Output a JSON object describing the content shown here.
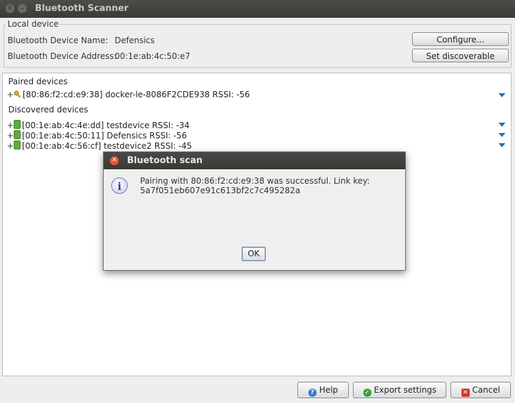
{
  "window": {
    "title": "Bluetooth Scanner"
  },
  "local": {
    "legend": "Local device",
    "name_label": "Bluetooth Device Name:",
    "name_value": "Defensics",
    "address_label": "Bluetooth Device Address:",
    "address_value": "00:1e:ab:4c:50:e7",
    "configure_label": "Configure...",
    "discoverable_label": "Set discoverable"
  },
  "paired": {
    "heading": "Paired devices",
    "items": [
      {
        "text": "[80:86:f2:cd:e9:38] docker-le-8086F2CDE938 RSSI: -56"
      }
    ]
  },
  "discovered": {
    "heading": "Discovered devices",
    "items": [
      {
        "text": "[00:1e:ab:4c:4e:dd] testdevice RSSI: -34"
      },
      {
        "text": "[00:1e:ab:4c:50:11] Defensics RSSI: -56"
      },
      {
        "text": "[00:1e:ab:4c:56:cf] testdevice2 RSSI: -45"
      }
    ]
  },
  "dialog": {
    "title": "Bluetooth scan",
    "message_line1": "Pairing with 80:86:f2:cd:e9:38 was successful. Link key:",
    "message_line2": "5a7f051eb607e91c613bf2c7c495282a",
    "ok_label": "OK"
  },
  "footer": {
    "help_label": "Help",
    "export_label": "Export settings",
    "cancel_label": "Cancel"
  },
  "colors": {
    "accent": "#2a6bc4",
    "device_green": "#5fae3a",
    "close_red": "#e4563a"
  },
  "icons": [
    "close-icon",
    "minimize-icon",
    "key-icon",
    "device-icon",
    "expand-arrow-icon",
    "info-icon",
    "help-icon",
    "check-icon",
    "cancel-icon"
  ]
}
